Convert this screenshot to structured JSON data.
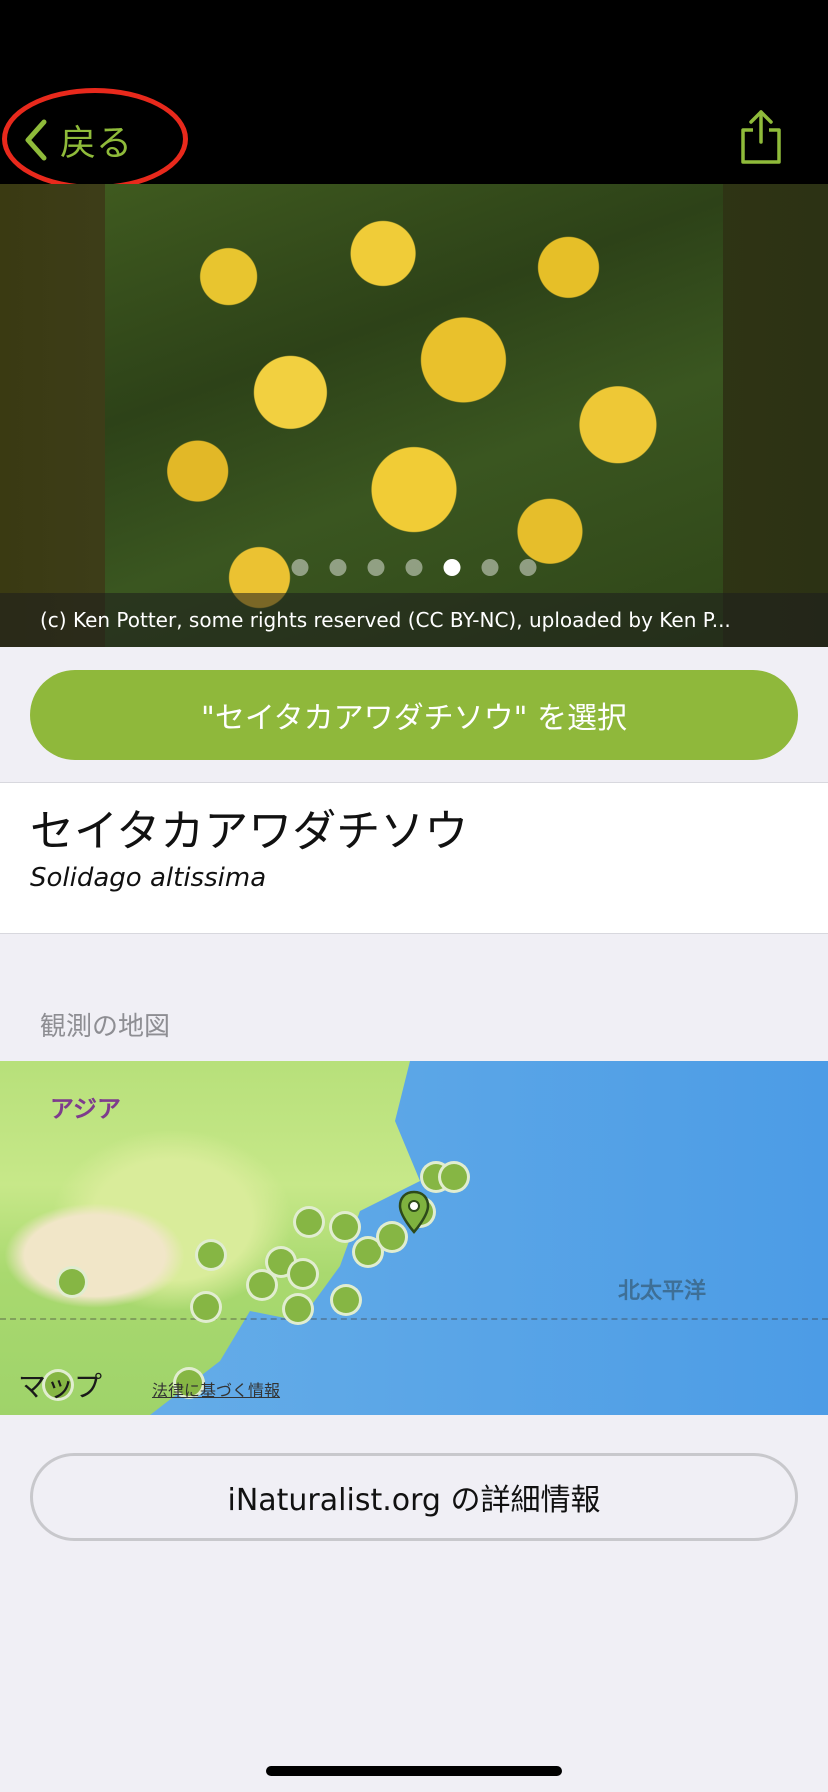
{
  "nav": {
    "back_label": "戻る",
    "icons": {
      "back": "chevron-left-icon",
      "share": "share-icon"
    },
    "accent_color": "#8fbb3a",
    "highlight_color": "#e8291c"
  },
  "photo": {
    "caption": "(c) Ken Potter, some rights reserved (CC BY-NC), uploaded by Ken P...",
    "page_count": 7,
    "active_page": 5
  },
  "select_button": {
    "label": "\"セイタカアワダチソウ\" を選択",
    "color": "#8fb83b"
  },
  "taxon": {
    "common_name": "セイタカアワダチソウ",
    "scientific_name": "Solidago altissima"
  },
  "map_section": {
    "label": "観測の地図",
    "labels": {
      "asia": "アジア",
      "pacific": "北太平洋"
    },
    "brand": "マップ",
    "legal": "法律に基づく情報"
  },
  "details_button": {
    "label": "iNaturalist.org の詳細情報"
  }
}
